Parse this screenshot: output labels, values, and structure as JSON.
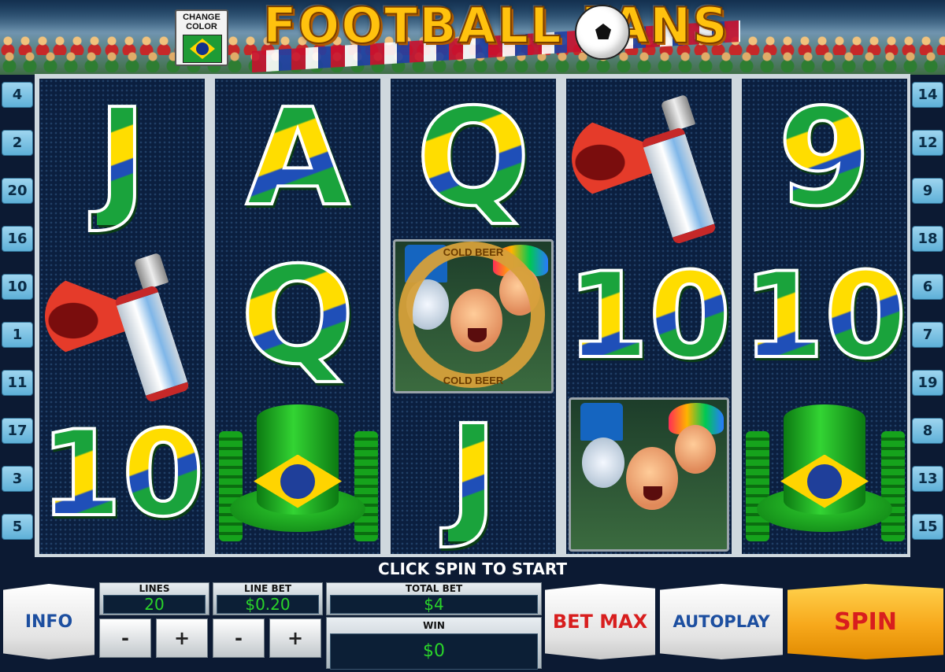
{
  "header": {
    "change_color_label": "CHANGE\nCOLOR",
    "logo_text": "FOOTBALL FANS"
  },
  "lines_left": [
    "4",
    "2",
    "20",
    "16",
    "10",
    "1",
    "11",
    "17",
    "3",
    "5"
  ],
  "lines_right": [
    "14",
    "12",
    "9",
    "18",
    "6",
    "7",
    "19",
    "8",
    "13",
    "15"
  ],
  "reels": [
    [
      "J",
      "air-horn",
      "10"
    ],
    [
      "A",
      "Q",
      "hat"
    ],
    [
      "Q",
      "cold-beer-fans",
      "J"
    ],
    [
      "air-horn",
      "10",
      "fans"
    ],
    [
      "9",
      "10",
      "hat"
    ]
  ],
  "bonus_symbol": {
    "ring_top": "COLD BEER",
    "ring_bottom": "COLD BEER"
  },
  "status_message": "CLICK SPIN TO START",
  "controls": {
    "info_label": "INFO",
    "lines": {
      "title": "LINES",
      "value": "20"
    },
    "line_bet": {
      "title": "LINE BET",
      "value": "$0.20"
    },
    "total_bet": {
      "title": "TOTAL BET",
      "value": "$4"
    },
    "win": {
      "title": "WIN",
      "value": "$0"
    },
    "minus": "-",
    "plus": "+",
    "bet_max_label": "BET MAX",
    "autoplay_label": "AUTOPLAY",
    "spin_label": "SPIN"
  },
  "colors": {
    "brazil_green": "#1aa33c",
    "brazil_yellow": "#ffd400",
    "brazil_blue": "#1f3f9a",
    "value_green": "#2ad42a",
    "spin_orange": "#f7a81b"
  }
}
